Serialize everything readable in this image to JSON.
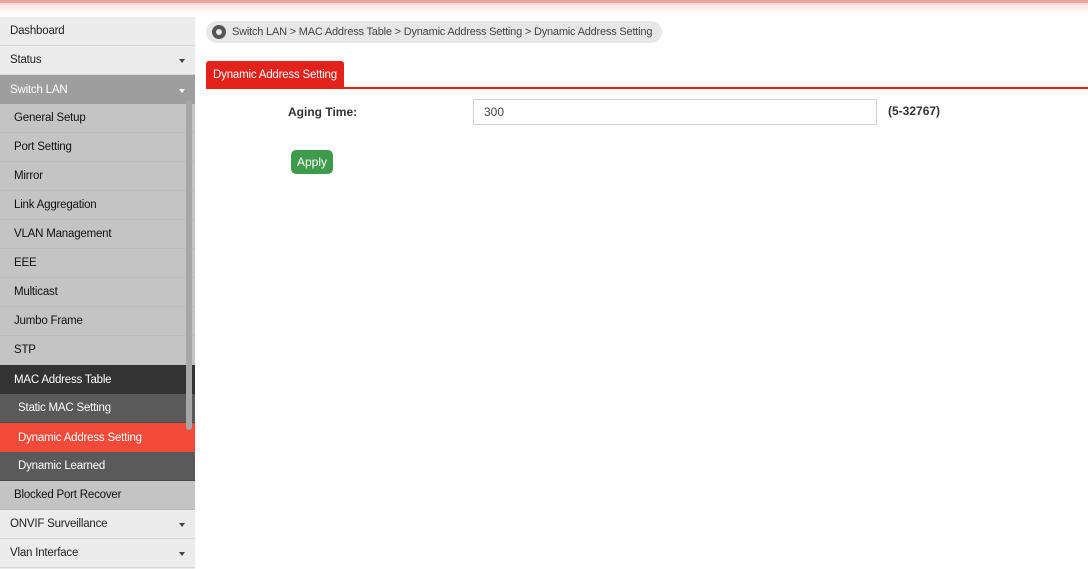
{
  "breadcrumb": {
    "text": "Switch LAN > MAC Address Table > Dynamic Address Setting  > Dynamic Address Setting"
  },
  "sidebar": {
    "items": [
      {
        "label": "Dashboard"
      },
      {
        "label": "Status"
      },
      {
        "label": "Switch LAN"
      },
      {
        "label": "General Setup"
      },
      {
        "label": "Port Setting"
      },
      {
        "label": "Mirror"
      },
      {
        "label": "Link Aggregation"
      },
      {
        "label": "VLAN Management"
      },
      {
        "label": "EEE"
      },
      {
        "label": "Multicast"
      },
      {
        "label": "Jumbo Frame"
      },
      {
        "label": "STP"
      },
      {
        "label": "MAC Address Table"
      },
      {
        "label": "Static MAC Setting"
      },
      {
        "label": "Dynamic Address Setting"
      },
      {
        "label": "Dynamic Learned"
      },
      {
        "label": "Blocked Port Recover"
      },
      {
        "label": "ONVIF Surveillance"
      },
      {
        "label": "Vlan Interface"
      }
    ]
  },
  "tab": {
    "label": "Dynamic Address Setting"
  },
  "form": {
    "aging_label": "Aging Time:",
    "aging_value": "300",
    "range_hint": "(5-32767)",
    "apply_label": "Apply"
  },
  "colors": {
    "accent": "#e3221b",
    "active_item": "#f34a3a",
    "apply_button": "#3f9b4b"
  }
}
